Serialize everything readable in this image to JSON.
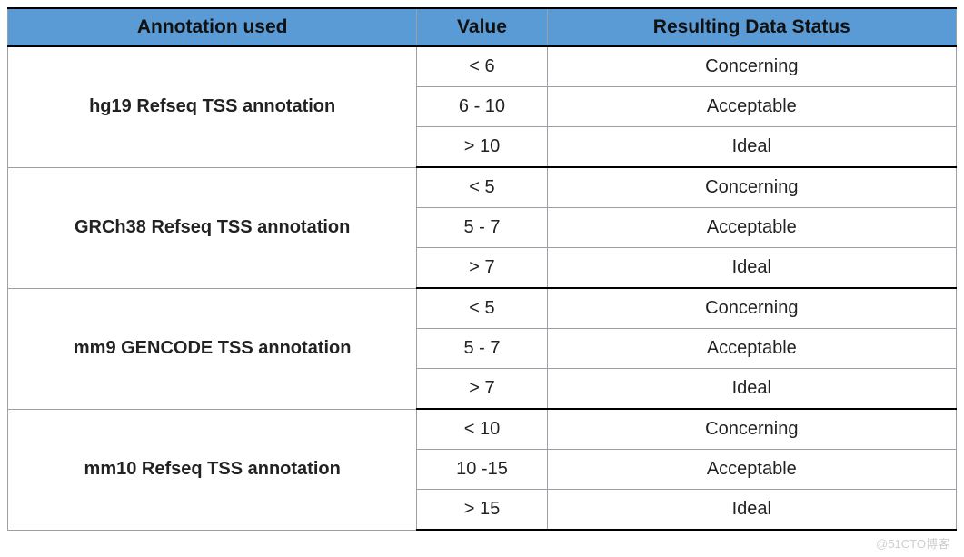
{
  "headers": {
    "annotation": "Annotation used",
    "value": "Value",
    "status": "Resulting Data Status"
  },
  "groups": [
    {
      "annotation": "hg19 Refseq TSS annotation",
      "rows": [
        {
          "value": "< 6",
          "status": "Concerning"
        },
        {
          "value": "6 - 10",
          "status": "Acceptable"
        },
        {
          "value": "> 10",
          "status": "Ideal"
        }
      ]
    },
    {
      "annotation": "GRCh38 Refseq TSS annotation",
      "rows": [
        {
          "value": "< 5",
          "status": "Concerning"
        },
        {
          "value": "5 - 7",
          "status": "Acceptable"
        },
        {
          "value": "> 7",
          "status": "Ideal"
        }
      ]
    },
    {
      "annotation": "mm9 GENCODE TSS annotation",
      "rows": [
        {
          "value": "< 5",
          "status": "Concerning"
        },
        {
          "value": "5 - 7",
          "status": "Acceptable"
        },
        {
          "value": "> 7",
          "status": "Ideal"
        }
      ]
    },
    {
      "annotation": "mm10 Refseq TSS annotation",
      "rows": [
        {
          "value": "< 10",
          "status": "Concerning"
        },
        {
          "value": "10 -15",
          "status": "Acceptable"
        },
        {
          "value": "> 15",
          "status": "Ideal"
        }
      ]
    }
  ],
  "watermark": "@51CTO博客"
}
